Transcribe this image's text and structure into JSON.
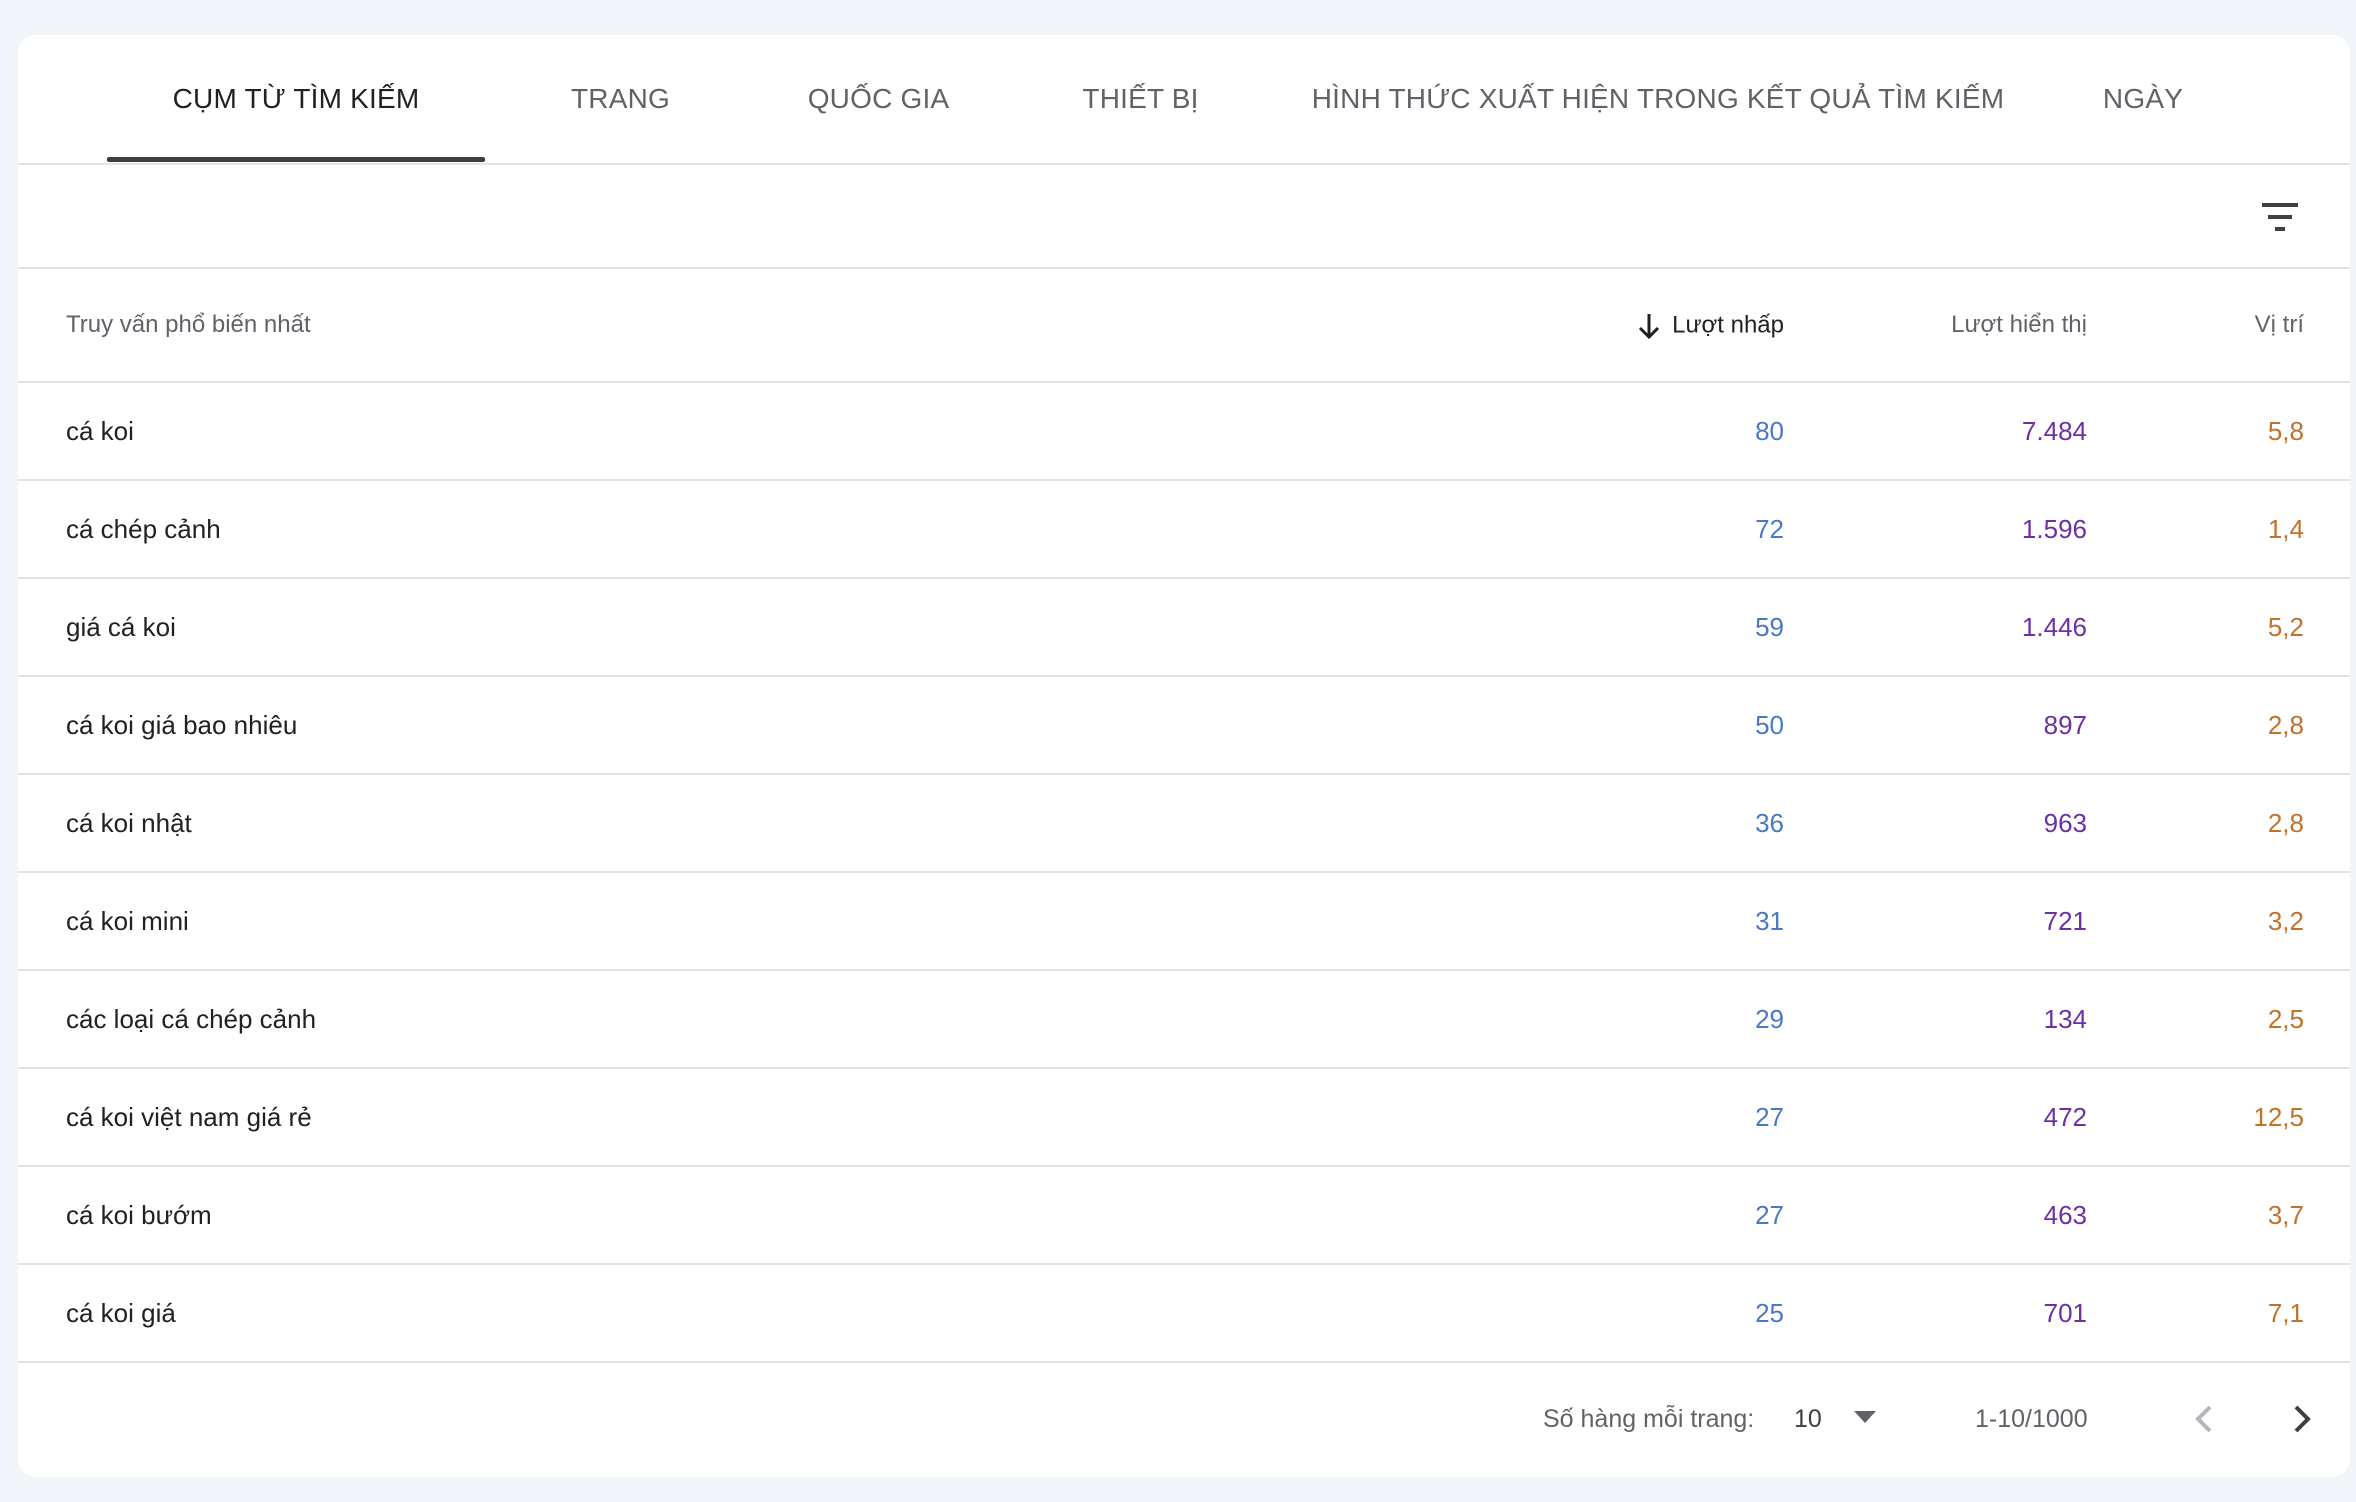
{
  "tabs": [
    {
      "label": "CỤM TỪ TÌM KIẾM",
      "active": true
    },
    {
      "label": "TRANG",
      "active": false
    },
    {
      "label": "QUỐC GIA",
      "active": false
    },
    {
      "label": "THIẾT BỊ",
      "active": false
    },
    {
      "label": "HÌNH THỨC XUẤT HIỆN TRONG KẾT QUẢ TÌM KIẾM",
      "active": false
    },
    {
      "label": "NGÀY",
      "active": false
    }
  ],
  "toolbar": {
    "filter_icon": "filter-icon"
  },
  "table": {
    "columns": {
      "query": "Truy vấn phổ biến nhất",
      "clicks": "Lượt nhấp",
      "impressions": "Lượt hiển thị",
      "position": "Vị trí"
    },
    "sort_icon": "arrow-down-icon",
    "rows": [
      {
        "query": "cá koi",
        "clicks": "80",
        "impressions": "7.484",
        "position": "5,8"
      },
      {
        "query": "cá chép cảnh",
        "clicks": "72",
        "impressions": "1.596",
        "position": "1,4"
      },
      {
        "query": "giá cá koi",
        "clicks": "59",
        "impressions": "1.446",
        "position": "5,2"
      },
      {
        "query": "cá koi giá bao nhiêu",
        "clicks": "50",
        "impressions": "897",
        "position": "2,8"
      },
      {
        "query": "cá koi nhật",
        "clicks": "36",
        "impressions": "963",
        "position": "2,8"
      },
      {
        "query": "cá koi mini",
        "clicks": "31",
        "impressions": "721",
        "position": "3,2"
      },
      {
        "query": "các loại cá chép cảnh",
        "clicks": "29",
        "impressions": "134",
        "position": "2,5"
      },
      {
        "query": "cá koi việt nam giá rẻ",
        "clicks": "27",
        "impressions": "472",
        "position": "12,5"
      },
      {
        "query": "cá koi bướm",
        "clicks": "27",
        "impressions": "463",
        "position": "3,7"
      },
      {
        "query": "cá koi giá",
        "clicks": "25",
        "impressions": "701",
        "position": "7,1"
      }
    ]
  },
  "footer": {
    "rows_per_page_label": "Số hàng mỗi trang:",
    "rows_per_page_value": "10",
    "range": "1-10/1000"
  },
  "colors": {
    "clicks": "#4a78c5",
    "impressions": "#6c2fa5",
    "position": "#c2712a"
  }
}
